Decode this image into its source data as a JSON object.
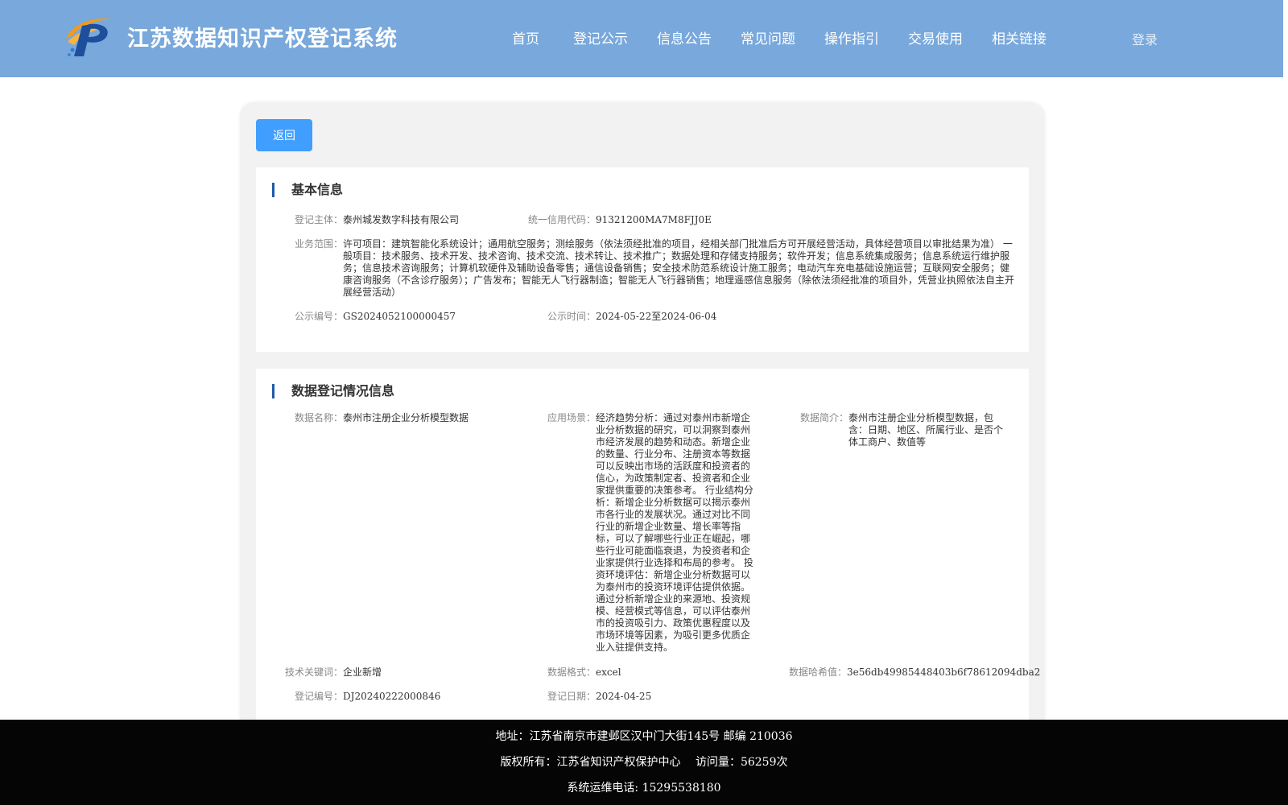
{
  "header": {
    "site_title": "江苏数据知识产权登记系统",
    "nav": [
      "首页",
      "登记公示",
      "信息公告",
      "常见问题",
      "操作指引",
      "交易使用",
      "相关链接"
    ],
    "login": "登录",
    "colors": {
      "bar": "#78a8dc",
      "logo_orange": "#f29a1e",
      "logo_blue": "#1d4f9c"
    }
  },
  "back_button": "返回",
  "basic_info": {
    "title": "基本信息",
    "entity_label": "登记主体：",
    "entity_value": "泰州城发数字科技有限公司",
    "credit_label": "统一信用代码：",
    "credit_value": "91321200MA7M8FJJ0E",
    "scope_label": "业务范围：",
    "scope_value": "许可项目：建筑智能化系统设计；通用航空服务；测绘服务（依法须经批准的项目，经相关部门批准后方可开展经营活动，具体经营项目以审批结果为准） 一般项目：技术服务、技术开发、技术咨询、技术交流、技术转让、技术推广；数据处理和存储支持服务；软件开发；信息系统集成服务；信息系统运行维护服务；信息技术咨询服务；计算机软硬件及辅助设备零售；通信设备销售；安全技术防范系统设计施工服务；电动汽车充电基础设施运营；互联网安全服务；健康咨询服务（不含诊疗服务）；广告发布；智能无人飞行器制造；智能无人飞行器销售；地理遥感信息服务（除依法须经批准的项目外，凭营业执照依法自主开展经营活动）",
    "notice_no_label": "公示编号：",
    "notice_no_value": "GS2024052100000457",
    "notice_time_label": "公示时间：",
    "notice_time_value": "2024-05-22至2024-06-04"
  },
  "data_info": {
    "title": "数据登记情况信息",
    "name_label": "数据名称：",
    "name_value": "泰州市注册企业分析模型数据",
    "scene_label": "应用场景：",
    "scene_value": "经济趋势分析：通过对泰州市新增企业分析数据的研究，可以洞察到泰州市经济发展的趋势和动态。新增企业的数量、行业分布、注册资本等数据可以反映出市场的活跃度和投资者的信心，为政策制定者、投资者和企业家提供重要的决策参考。 行业结构分析：新增企业分析数据可以揭示泰州市各行业的发展状况。通过对比不同行业的新增企业数量、增长率等指标，可以了解哪些行业正在崛起，哪些行业可能面临衰退，为投资者和企业家提供行业选择和布局的参考。 投资环境评估：新增企业分析数据可以为泰州市的投资环境评估提供依据。通过分析新增企业的来源地、投资规模、经营模式等信息，可以评估泰州市的投资吸引力、政策优惠程度以及市场环境等因素，为吸引更多优质企业入驻提供支持。",
    "intro_label": "数据简介：",
    "intro_value": "泰州市注册企业分析模型数据，包含：日期、地区、所属行业、是否个体工商户、数值等",
    "keyword_label": "技术关键词：",
    "keyword_value": "企业新增",
    "format_label": "数据格式：",
    "format_value": "excel",
    "hash_label": "数据哈希值：",
    "hash_value": "3e56db49985448403b6f78612094dba2",
    "reg_no_label": "登记编号：",
    "reg_no_value": "DJ20240222000846",
    "reg_date_label": "登记日期：",
    "reg_date_value": "2024-04-25"
  },
  "footer": {
    "address": "地址：江苏省南京市建邺区汉中门大街145号 邮编 210036",
    "copyright": "版权所有：江苏省知识产权保护中心　 访问量：56259次",
    "hotline": "系统运维电话: 15295538180"
  }
}
